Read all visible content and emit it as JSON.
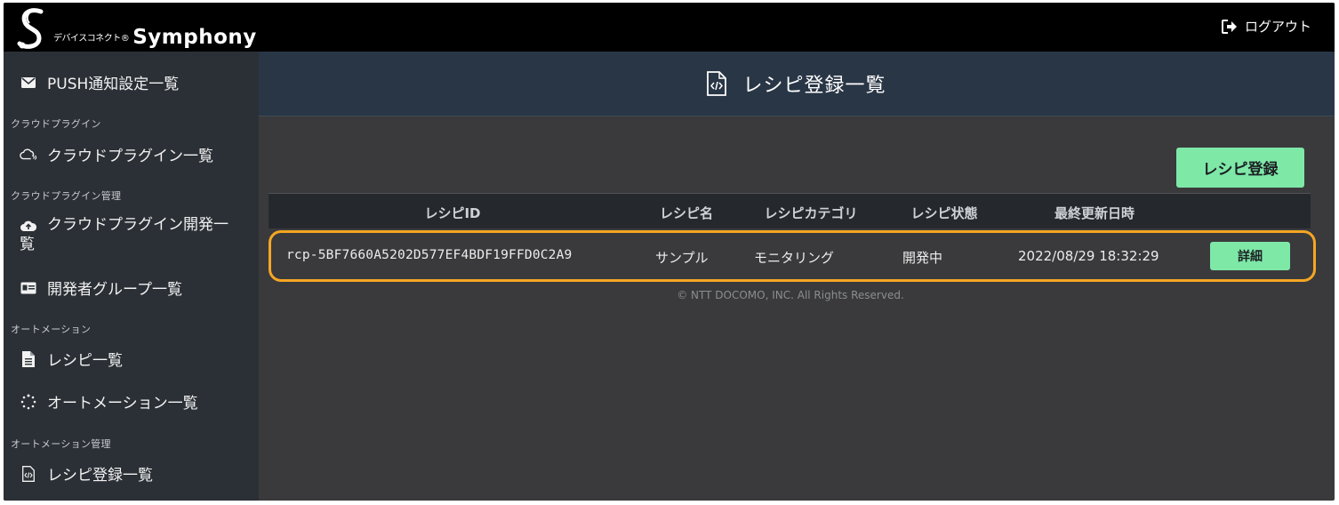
{
  "header": {
    "brand_sub": "デバイスコネクト®",
    "brand_main": "Symphony",
    "logout_label": "ログアウト"
  },
  "sidebar": {
    "push_label": "PUSH通知設定一覧",
    "section_cloud": "クラウドプラグイン",
    "cloud_list_label": "クラウドプラグイン一覧",
    "section_cloud_admin": "クラウドプラグイン管理",
    "cloud_dev_label_1": "クラウドプラグイン開発一",
    "cloud_dev_label_2": "覧",
    "dev_group_label": "開発者グループ一覧",
    "section_automation": "オートメーション",
    "recipe_list_label": "レシピ一覧",
    "automation_list_label": "オートメーション一覧",
    "section_automation_admin": "オートメーション管理",
    "recipe_register_list_label": "レシピ登録一覧"
  },
  "main": {
    "title": "レシピ登録一覧",
    "register_button": "レシピ登録",
    "columns": [
      "レシピID",
      "レシピ名",
      "レシピカテゴリ",
      "レシピ状態",
      "最終更新日時"
    ],
    "rows": [
      {
        "id": "rcp-5BF7660A5202D577EF4BDF19FFD0C2A9",
        "name": "サンプル",
        "category": "モニタリング",
        "status": "開発中",
        "updated": "2022/08/29 18:32:29",
        "detail_label": "詳細"
      }
    ],
    "footer": "© NTT DOCOMO, INC. All Rights Reserved."
  },
  "colors": {
    "accent_green": "#7ee8a7",
    "highlight_orange": "#f5a623",
    "sidebar_bg": "#2b3036",
    "title_bar_bg": "#293646"
  }
}
